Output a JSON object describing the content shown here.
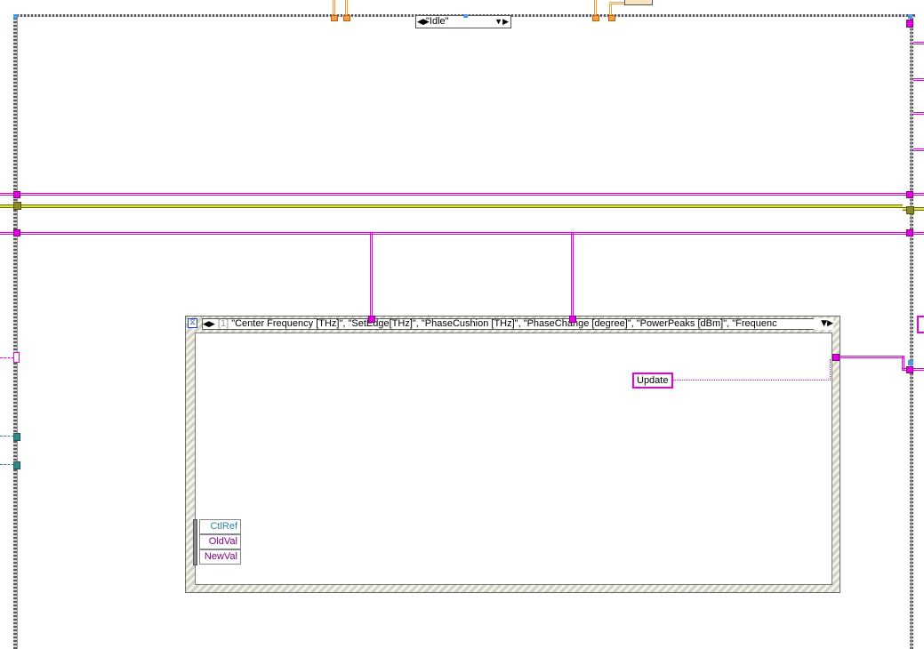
{
  "case_selector": {
    "value": "\"Idle\""
  },
  "event_structure": {
    "event_index": "[1]",
    "event_label": " \"Center Frequency [THz]\", \"SetEdge[THz]\", \"PhaseCushion [THz]\", \"PhaseChange [degree]\", \"PowerPeaks [dBm]\", \"Frequenc"
  },
  "constants": {
    "update_label": "Update"
  },
  "event_data_node": {
    "items": [
      "CtlRef",
      "OldVal",
      "NewVal"
    ],
    "colors": {
      "ctlref": "#2a8a9a",
      "oldval": "#800080",
      "newval": "#800080"
    }
  },
  "wire_colors": {
    "reference": "#e600e6",
    "error": "#8a8a2a",
    "numeric": "#f5a03c",
    "refnum": "#2d8a8a"
  }
}
